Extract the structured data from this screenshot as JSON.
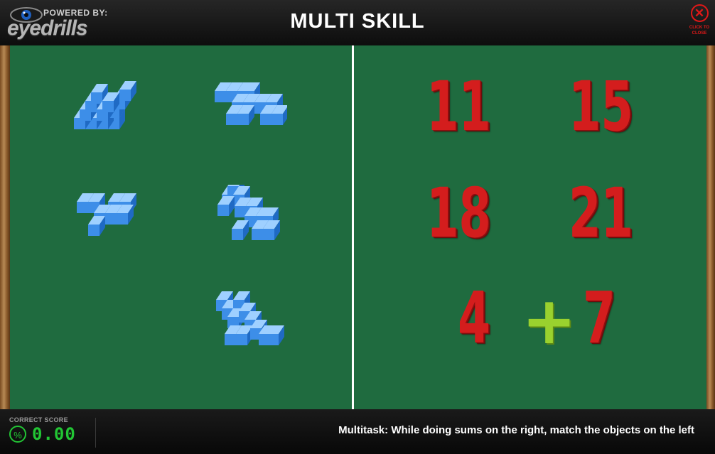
{
  "header": {
    "powered_by": "POWERED BY:",
    "brand": "eyedrills",
    "title": "MULTI SKILL",
    "close_label_1": "CLICK TO",
    "close_label_2": "CLOSE"
  },
  "board": {
    "left_objects": [
      "blocks-a",
      "blocks-b",
      "blocks-c",
      "blocks-d",
      "blocks-e"
    ],
    "answer_choices": [
      "11",
      "15",
      "18",
      "21"
    ],
    "problem": {
      "left": "4",
      "operator": "+",
      "right": "7"
    }
  },
  "footer": {
    "score_label": "CORRECT SCORE",
    "score_icon": "%",
    "score_value": "0.00",
    "instructions": "Multitask: While doing sums on the right, match the objects on the left"
  },
  "colors": {
    "board": "#1f6b3f",
    "numbers": "#d41d1d",
    "plus": "#9ad12e",
    "score": "#22c534",
    "close": "#e01818"
  }
}
